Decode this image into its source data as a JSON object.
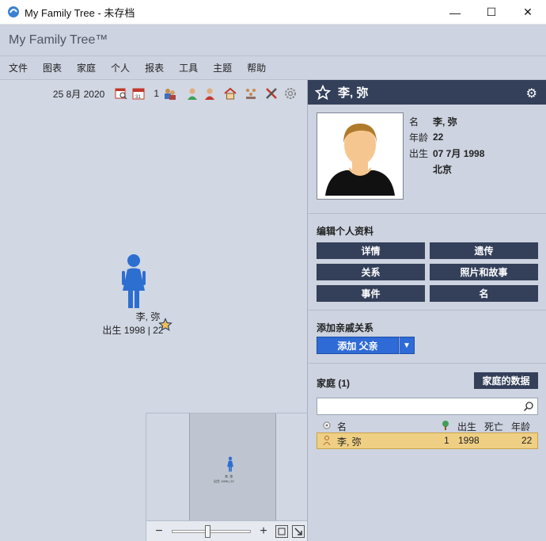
{
  "window": {
    "title": "My Family Tree - 未存档",
    "minimize": "—",
    "maximize": "☐",
    "close": "✕"
  },
  "header": {
    "brand": "My Family Tree™"
  },
  "menu": [
    "文件",
    "图表",
    "家庭",
    "个人",
    "报表",
    "工具",
    "主题",
    "帮助"
  ],
  "toolbar": {
    "date": "25 8月 2020",
    "generation_count": "1"
  },
  "chart_person": {
    "name": "李, 弥",
    "meta": "出生 1998 | 22"
  },
  "minimap": {
    "name": "李, 弥",
    "meta": "出生 1998 | 22"
  },
  "zoom": {
    "minus": "−",
    "plus": "+",
    "level": 0.45
  },
  "panel": {
    "name": "李, 弥",
    "facts": [
      {
        "key": "名",
        "value": "李, 弥"
      },
      {
        "key": "年龄",
        "value": "22"
      },
      {
        "key": "出生",
        "value": "07 7月 1998"
      },
      {
        "key": "",
        "value": "北京"
      }
    ],
    "edit_title": "编辑个人资料",
    "edit_buttons": [
      "详情",
      "遗传",
      "关系",
      "照片和故事",
      "事件",
      "名"
    ],
    "add_rel_title": "添加亲戚关系",
    "add_button": "添加 父亲",
    "family_title": "家庭 (1)",
    "family_data_button": "家庭的数据",
    "search_placeholder": "",
    "table_headers": {
      "name": "名",
      "gen": "",
      "birth": "出生",
      "death": "死亡",
      "age": "年龄"
    },
    "table_rows": [
      {
        "name": "李, 弥",
        "gen": "1",
        "birth": "1998",
        "death": "",
        "age": "22"
      }
    ]
  },
  "colors": {
    "panel_header": "#34405a",
    "accent_blue": "#2f6bd6",
    "person_blue": "#2d6fd0",
    "row_highlight": "#efcf84"
  }
}
